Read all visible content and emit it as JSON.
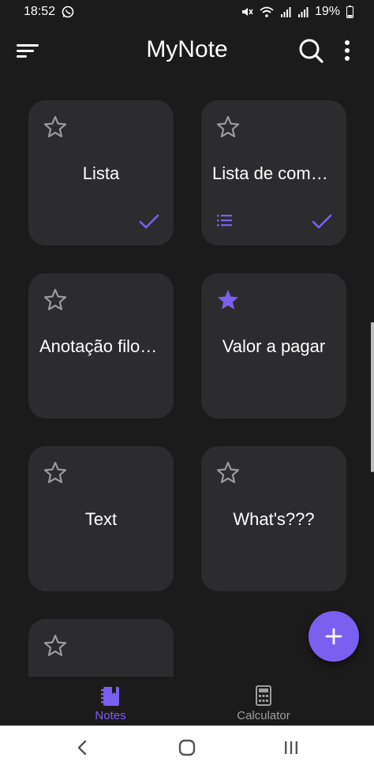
{
  "status_bar": {
    "time": "18:52",
    "battery": "19%",
    "icons": [
      "whatsapp-icon",
      "mute-icon",
      "wifi-icon",
      "signal-icon",
      "signal-icon",
      "battery-icon"
    ]
  },
  "app_bar": {
    "title": "MyNote",
    "icons": [
      "sort-menu-icon",
      "search-icon",
      "more-vert-icon"
    ]
  },
  "notes": [
    {
      "title": "Lista",
      "starred": false,
      "checked": true,
      "has_list": false
    },
    {
      "title": "Lista de compras",
      "starred": false,
      "checked": true,
      "has_list": true
    },
    {
      "title": "Anotação filosófica",
      "starred": false,
      "checked": false,
      "has_list": false
    },
    {
      "title": "Valor a pagar",
      "starred": true,
      "checked": false,
      "has_list": false
    },
    {
      "title": "Text",
      "starred": false,
      "checked": false,
      "has_list": false
    },
    {
      "title": "What's???",
      "starred": false,
      "checked": false,
      "has_list": false
    },
    {
      "title": "",
      "starred": false,
      "checked": false,
      "has_list": false
    }
  ],
  "fab": {
    "icon": "plus-icon"
  },
  "bottom_nav": {
    "items": [
      {
        "label": "Notes",
        "icon": "notebook-icon",
        "active": true
      },
      {
        "label": "Calculator",
        "icon": "calculator-icon",
        "active": false
      }
    ]
  },
  "system_nav": {
    "icons": [
      "back-icon",
      "home-icon",
      "recents-icon"
    ]
  },
  "colors": {
    "background": "#1b1b1c",
    "card": "#2c2c2e",
    "accent": "#7b5ff0",
    "inactive": "#9e9e9e",
    "text": "#ffffff"
  }
}
